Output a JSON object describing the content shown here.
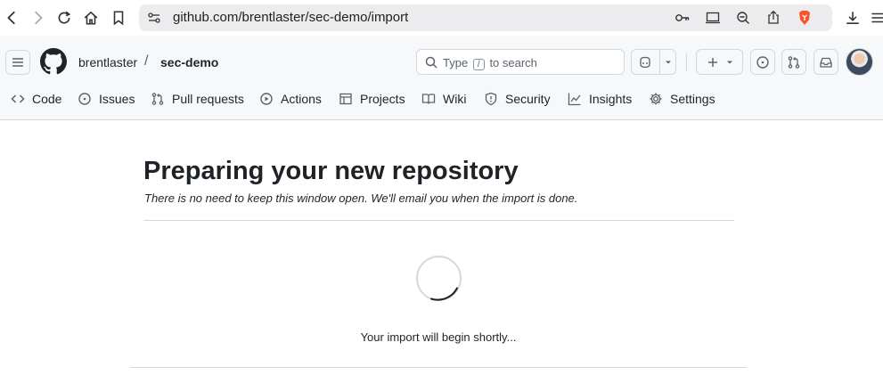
{
  "browser": {
    "url": "github.com/brentlaster/sec-demo/import"
  },
  "header": {
    "owner": "brentlaster",
    "separator": "/",
    "repo": "sec-demo",
    "search": {
      "prefix": "Type",
      "key": "/",
      "suffix": "to search"
    }
  },
  "tabs": [
    {
      "label": "Code",
      "icon": "code-icon"
    },
    {
      "label": "Issues",
      "icon": "issue-opened-icon"
    },
    {
      "label": "Pull requests",
      "icon": "git-pull-request-icon"
    },
    {
      "label": "Actions",
      "icon": "play-icon"
    },
    {
      "label": "Projects",
      "icon": "table-icon"
    },
    {
      "label": "Wiki",
      "icon": "book-icon"
    },
    {
      "label": "Security",
      "icon": "shield-icon"
    },
    {
      "label": "Insights",
      "icon": "graph-icon"
    },
    {
      "label": "Settings",
      "icon": "gear-icon"
    }
  ],
  "main": {
    "title": "Preparing your new repository",
    "subtitle": "There is no need to keep this window open. We'll email you when the import is done.",
    "status": "Your import will begin shortly..."
  }
}
